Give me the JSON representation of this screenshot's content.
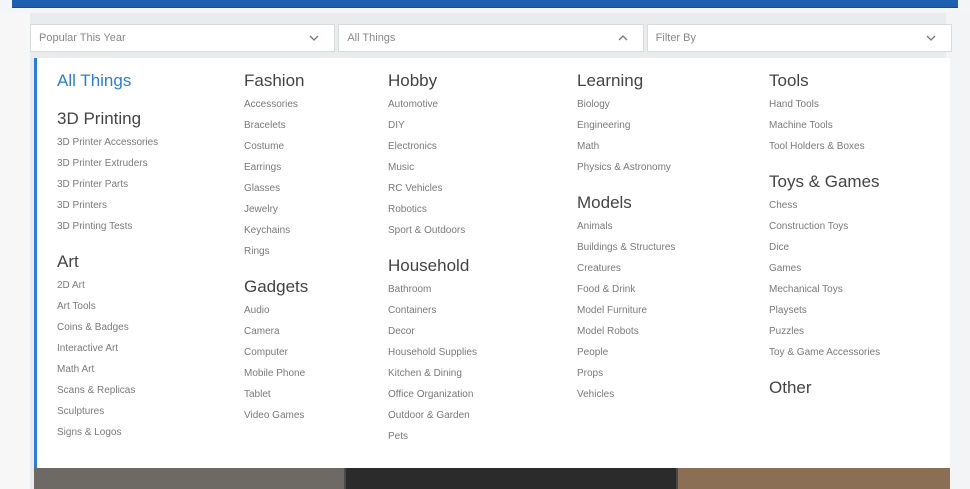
{
  "filters": {
    "sort": {
      "value": "Popular This Year"
    },
    "category": {
      "value": "All Things"
    },
    "filter": {
      "value": "Filter By"
    }
  },
  "columns": [
    {
      "groups": [
        {
          "title": "All Things",
          "active": true,
          "items": []
        },
        {
          "title": "3D Printing",
          "items": [
            "3D Printer Accessories",
            "3D Printer Extruders",
            "3D Printer Parts",
            "3D Printers",
            "3D Printing Tests"
          ]
        },
        {
          "title": "Art",
          "items": [
            "2D Art",
            "Art Tools",
            "Coins & Badges",
            "Interactive Art",
            "Math Art",
            "Scans & Replicas",
            "Sculptures",
            "Signs & Logos"
          ]
        }
      ]
    },
    {
      "groups": [
        {
          "title": "Fashion",
          "items": [
            "Accessories",
            "Bracelets",
            "Costume",
            "Earrings",
            "Glasses",
            "Jewelry",
            "Keychains",
            "Rings"
          ]
        },
        {
          "title": "Gadgets",
          "items": [
            "Audio",
            "Camera",
            "Computer",
            "Mobile Phone",
            "Tablet",
            "Video Games"
          ]
        }
      ]
    },
    {
      "groups": [
        {
          "title": "Hobby",
          "items": [
            "Automotive",
            "DIY",
            "Electronics",
            "Music",
            "RC Vehicles",
            "Robotics",
            "Sport & Outdoors"
          ]
        },
        {
          "title": "Household",
          "items": [
            "Bathroom",
            "Containers",
            "Decor",
            "Household Supplies",
            "Kitchen & Dining",
            "Office Organization",
            "Outdoor & Garden",
            "Pets"
          ]
        }
      ]
    },
    {
      "groups": [
        {
          "title": "Learning",
          "items": [
            "Biology",
            "Engineering",
            "Math",
            "Physics & Astronomy"
          ]
        },
        {
          "title": "Models",
          "items": [
            "Animals",
            "Buildings & Structures",
            "Creatures",
            "Food & Drink",
            "Model Furniture",
            "Model Robots",
            "People",
            "Props",
            "Vehicles"
          ]
        }
      ]
    },
    {
      "groups": [
        {
          "title": "Tools",
          "items": [
            "Hand Tools",
            "Machine Tools",
            "Tool Holders & Boxes"
          ]
        },
        {
          "title": "Toys & Games",
          "items": [
            "Chess",
            "Construction Toys",
            "Dice",
            "Games",
            "Mechanical Toys",
            "Playsets",
            "Puzzles",
            "Toy & Game Accessories"
          ]
        },
        {
          "title": "Other",
          "items": []
        }
      ]
    }
  ],
  "colors": {
    "accent_blue": "#2a7fd1",
    "top_bar_blue": "#1e5fb0"
  },
  "icons": {
    "sort_chevron": "chevron-down-icon",
    "category_chevron": "chevron-up-icon",
    "filter_chevron": "chevron-down-icon"
  }
}
